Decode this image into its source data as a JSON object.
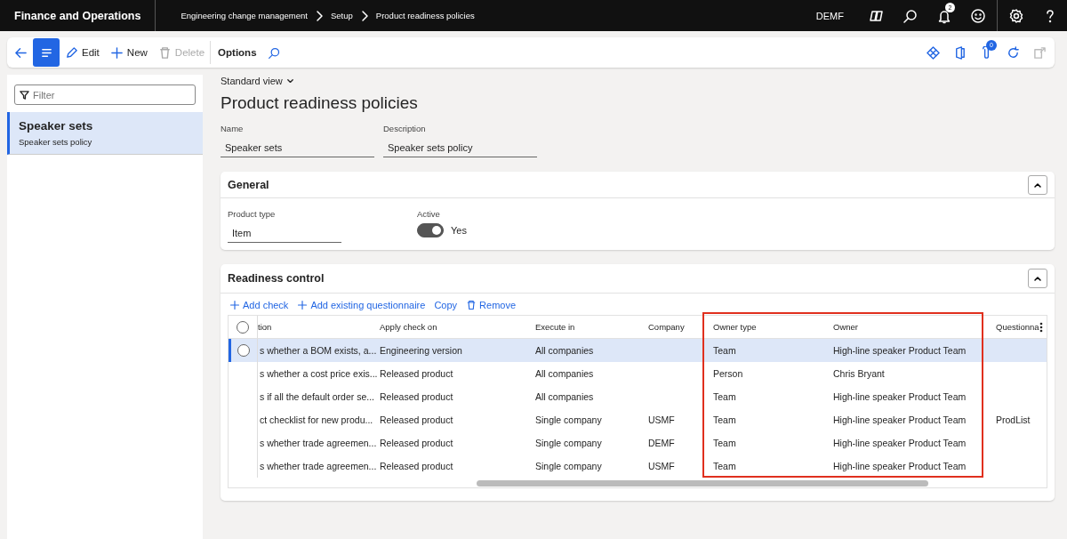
{
  "top_bar": {
    "app_title": "Finance and Operations",
    "breadcrumb": [
      "Engineering change management",
      "Setup",
      "Product readiness policies"
    ],
    "company": "DEMF",
    "notification_count": "2"
  },
  "toolbar": {
    "buttons": [
      {
        "kind": "edit",
        "label": "Edit",
        "disabled": false
      },
      {
        "kind": "new",
        "label": "New",
        "disabled": false
      },
      {
        "kind": "delete",
        "label": "Delete",
        "disabled": true
      }
    ],
    "options": "Options",
    "attachment_count": "0"
  },
  "sidebar": {
    "filter": {
      "placeholder": "Filter"
    },
    "items": [
      {
        "title": "Speaker sets",
        "subtitle": "Speaker sets policy",
        "selected": true
      }
    ]
  },
  "view": "Standard view",
  "page_title": "Product readiness policies",
  "fields": [
    {
      "label": "Name",
      "value": "Speaker sets"
    },
    {
      "label": "Description",
      "value": "Speaker sets policy"
    }
  ],
  "general": {
    "title": "General",
    "expanded": true,
    "product_type": {
      "label": "Product type",
      "value": "Item"
    },
    "active": {
      "label": "Active",
      "on": true,
      "text": "Yes"
    }
  },
  "readiness": {
    "title": "Readiness control",
    "expanded": true,
    "actions": [
      {
        "kind": "add",
        "label": "Add check"
      },
      {
        "kind": "add",
        "label": "Add existing questionnaire"
      },
      {
        "kind": "plain",
        "label": "Copy"
      },
      {
        "kind": "delete",
        "label": "Remove"
      }
    ],
    "all_selected": false,
    "columns": [
      {
        "label": "tion",
        "highlighted": false
      },
      {
        "label": "Apply check on",
        "highlighted": false
      },
      {
        "label": "Execute in",
        "highlighted": false
      },
      {
        "label": "Company",
        "highlighted": false
      },
      {
        "label": "Owner type",
        "highlighted": true
      },
      {
        "label": "Owner",
        "highlighted": true
      },
      {
        "label": "Questionna",
        "highlighted": false
      }
    ],
    "rows": [
      {
        "selected": true,
        "cells": [
          "s whether a BOM exists, a...",
          "Engineering version",
          "All companies",
          "",
          "Team",
          "High-line speaker Product Team",
          ""
        ]
      },
      {
        "selected": false,
        "cells": [
          "s whether a cost price exis...",
          "Released product",
          "All companies",
          "",
          "Person",
          "Chris Bryant",
          ""
        ]
      },
      {
        "selected": false,
        "cells": [
          "s if all the default order se...",
          "Released product",
          "All companies",
          "",
          "Team",
          "High-line speaker Product Team",
          ""
        ]
      },
      {
        "selected": false,
        "cells": [
          "ct checklist for new produ...",
          "Released product",
          "Single company",
          "USMF",
          "Team",
          "High-line speaker Product Team",
          "ProdList"
        ]
      },
      {
        "selected": false,
        "cells": [
          "s whether trade agreemen...",
          "Released product",
          "Single company",
          "DEMF",
          "Team",
          "High-line speaker Product Team",
          ""
        ]
      },
      {
        "selected": false,
        "cells": [
          "s whether trade agreemen...",
          "Released product",
          "Single company",
          "USMF",
          "Team",
          "High-line speaker Product Team",
          ""
        ]
      }
    ]
  }
}
